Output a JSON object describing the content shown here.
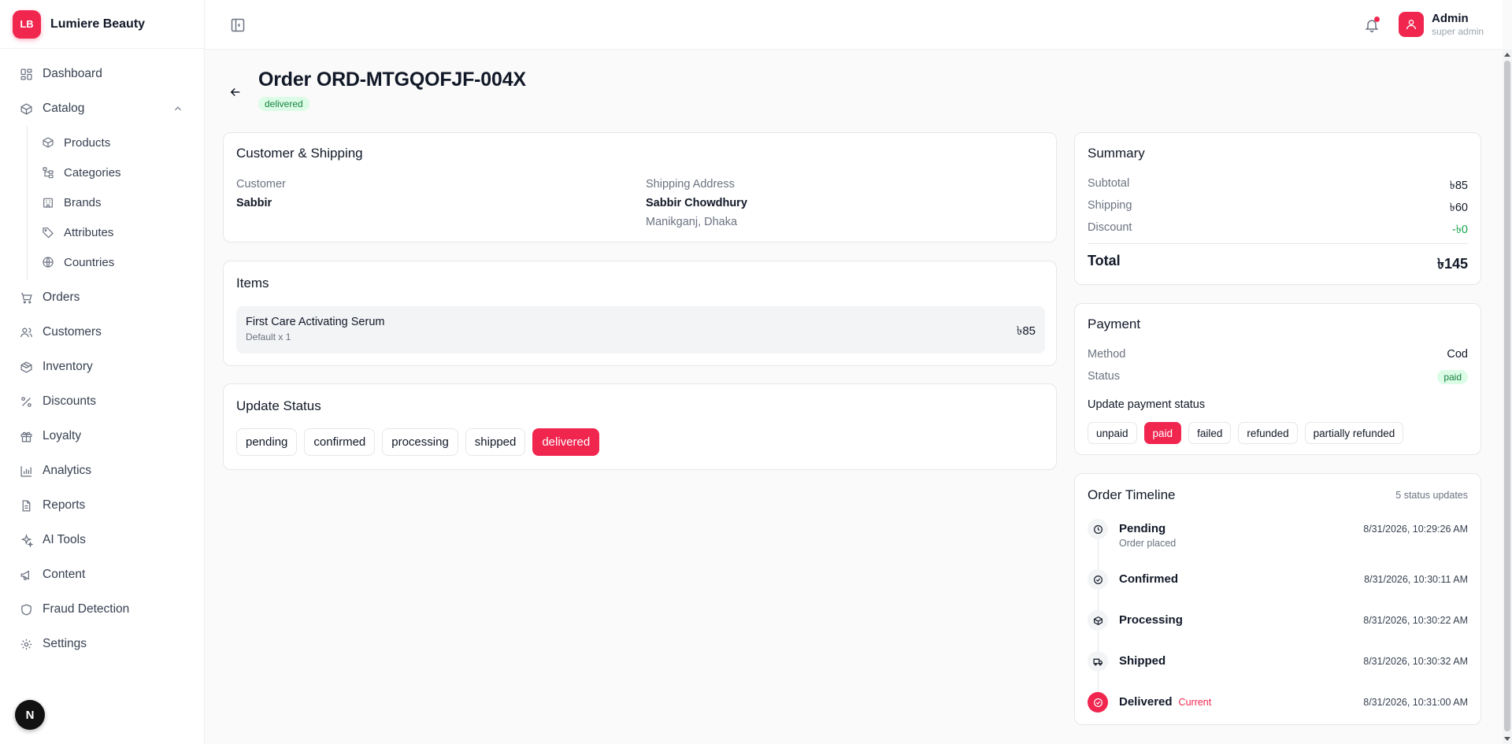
{
  "brand": {
    "logo": "LB",
    "name": "Lumiere Beauty"
  },
  "sidebar": {
    "items": [
      {
        "label": "Dashboard",
        "icon": "dashboard-icon"
      },
      {
        "label": "Catalog",
        "icon": "box-icon"
      },
      {
        "label": "Orders",
        "icon": "cart-icon"
      },
      {
        "label": "Customers",
        "icon": "users-icon"
      },
      {
        "label": "Inventory",
        "icon": "package-icon"
      },
      {
        "label": "Discounts",
        "icon": "percent-icon"
      },
      {
        "label": "Loyalty",
        "icon": "gift-icon"
      },
      {
        "label": "Analytics",
        "icon": "chart-icon"
      },
      {
        "label": "Reports",
        "icon": "file-icon"
      },
      {
        "label": "AI Tools",
        "icon": "sparkle-icon"
      },
      {
        "label": "Content",
        "icon": "megaphone-icon"
      },
      {
        "label": "Fraud Detection",
        "icon": "shield-icon"
      },
      {
        "label": "Settings",
        "icon": "gear-icon"
      }
    ],
    "catalog_sub": [
      {
        "label": "Products",
        "icon": "box-icon"
      },
      {
        "label": "Categories",
        "icon": "tree-icon"
      },
      {
        "label": "Brands",
        "icon": "building-icon"
      },
      {
        "label": "Attributes",
        "icon": "tag-icon"
      },
      {
        "label": "Countries",
        "icon": "globe-icon"
      }
    ],
    "bottom_badge": "N"
  },
  "header": {
    "user_name": "Admin",
    "user_role": "super admin"
  },
  "order": {
    "title": "Order ORD-MTGQOFJF-004X",
    "status_badge": "delivered",
    "customer_card": {
      "title": "Customer & Shipping",
      "customer_label": "Customer",
      "customer_name": "Sabbir",
      "shipping_label": "Shipping Address",
      "shipping_name": "Sabbir Chowdhury",
      "shipping_address": "Manikganj, Dhaka"
    },
    "items_card": {
      "title": "Items",
      "items": [
        {
          "name": "First Care Activating Serum",
          "variant": "Default x 1",
          "price": "৳85"
        }
      ]
    },
    "update_status": {
      "title": "Update Status",
      "options": [
        "pending",
        "confirmed",
        "processing",
        "shipped",
        "delivered"
      ],
      "active": "delivered"
    },
    "summary": {
      "title": "Summary",
      "subtotal_label": "Subtotal",
      "subtotal": "৳85",
      "shipping_label": "Shipping",
      "shipping": "৳60",
      "discount_label": "Discount",
      "discount": "-৳0",
      "total_label": "Total",
      "total": "৳145"
    },
    "payment": {
      "title": "Payment",
      "method_label": "Method",
      "method": "Cod",
      "status_label": "Status",
      "status": "paid",
      "update_label": "Update payment status",
      "options": [
        "unpaid",
        "paid",
        "failed",
        "refunded",
        "partially refunded"
      ],
      "active": "paid"
    },
    "timeline": {
      "title": "Order Timeline",
      "count": "5 status updates",
      "current_label": "Current",
      "events": [
        {
          "name": "Pending",
          "note": "Order placed",
          "time": "8/31/2026, 10:29:26 AM",
          "icon": "clock-icon"
        },
        {
          "name": "Confirmed",
          "note": "",
          "time": "8/31/2026, 10:30:11 AM",
          "icon": "check-circle-icon"
        },
        {
          "name": "Processing",
          "note": "",
          "time": "8/31/2026, 10:30:22 AM",
          "icon": "package-icon"
        },
        {
          "name": "Shipped",
          "note": "",
          "time": "8/31/2026, 10:30:32 AM",
          "icon": "truck-icon"
        },
        {
          "name": "Delivered",
          "note": "",
          "time": "8/31/2026, 10:31:00 AM",
          "icon": "check-circle-icon"
        }
      ]
    }
  },
  "colors": {
    "accent": "#f0264f",
    "success_bg": "#dcfce7",
    "success_text": "#15803d",
    "discount_text": "#16a34a"
  }
}
